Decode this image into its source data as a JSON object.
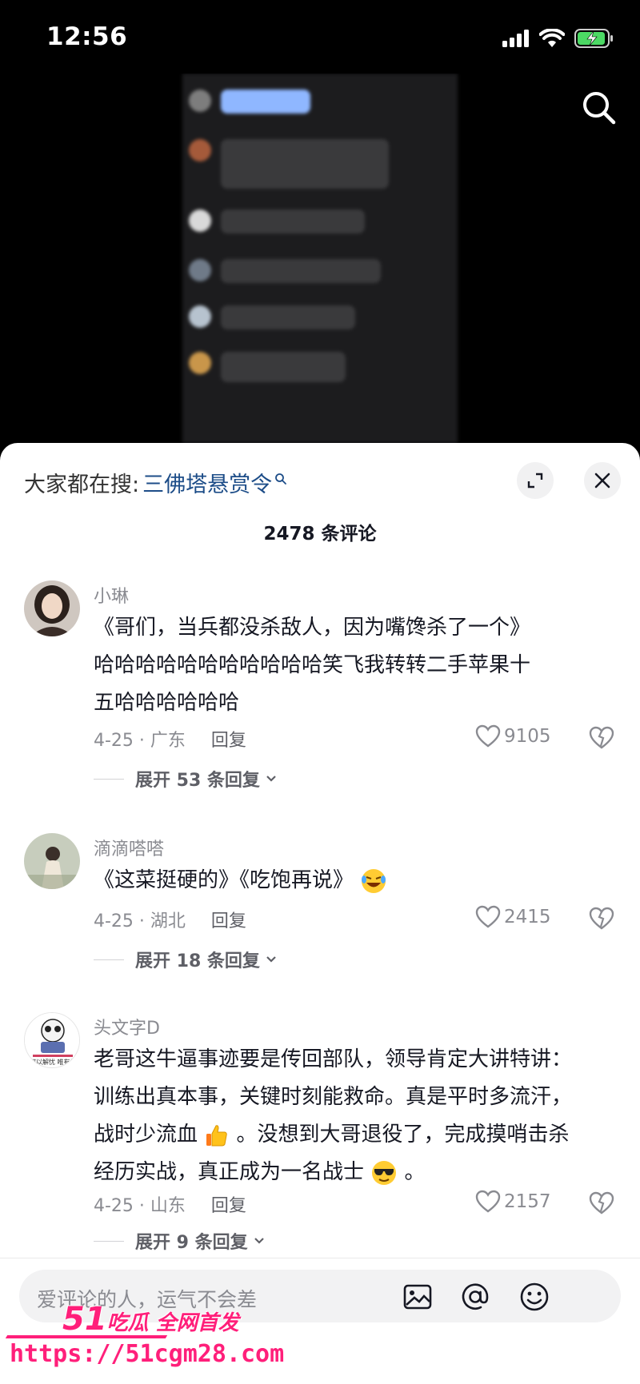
{
  "status_bar": {
    "time": "12:56"
  },
  "panel": {
    "hot_search_label": "大家都在搜:",
    "hot_search_term": "三佛塔悬赏令",
    "comment_count": "2478 条评论"
  },
  "comments": [
    {
      "user": "小琳",
      "lines": [
        "《哥们，当兵都没杀敌人，因为嘴馋杀了一个》",
        "哈哈哈哈哈哈哈哈哈哈哈笑飞我转转二手苹果十",
        "五哈哈哈哈哈哈"
      ],
      "date_location": "4-25 · 广东",
      "reply_label": "回复",
      "likes": "9105",
      "expand_label": "展开 53 条回复"
    },
    {
      "user": "滴滴嗒嗒",
      "lines": [
        "《这菜挺硬的》《吃饱再说》"
      ],
      "date_location": "4-25 · 湖北",
      "reply_label": "回复",
      "likes": "2415",
      "expand_label": "展开 18 条回复"
    },
    {
      "user": "头文字D",
      "lines": [
        "老哥这牛逼事迹要是传回部队，领导肯定大讲特讲：",
        "训练出真本事，关键时刻能救命。真是平时多流汗，",
        "战时少流血",
        "。没想到大哥退役了，完成摸哨击杀",
        "经历实战，真正成为一名战士",
        "。"
      ],
      "avatar_caption": "何以解忧 唯有暴富",
      "date_location": "4-25 · 山东",
      "reply_label": "回复",
      "likes": "2157",
      "expand_label": "展开 9 条回复"
    }
  ],
  "input": {
    "placeholder": "爱评论的人，运气不会差"
  },
  "watermark": {
    "line1_num": "51",
    "line1_text": "吃瓜 全网首发",
    "line2": "https://51cgm28.com"
  },
  "colors": {
    "link_blue": "#1d4d88",
    "text_gray": "#8a8b91",
    "watermark_pink": "#ff1f7a"
  }
}
